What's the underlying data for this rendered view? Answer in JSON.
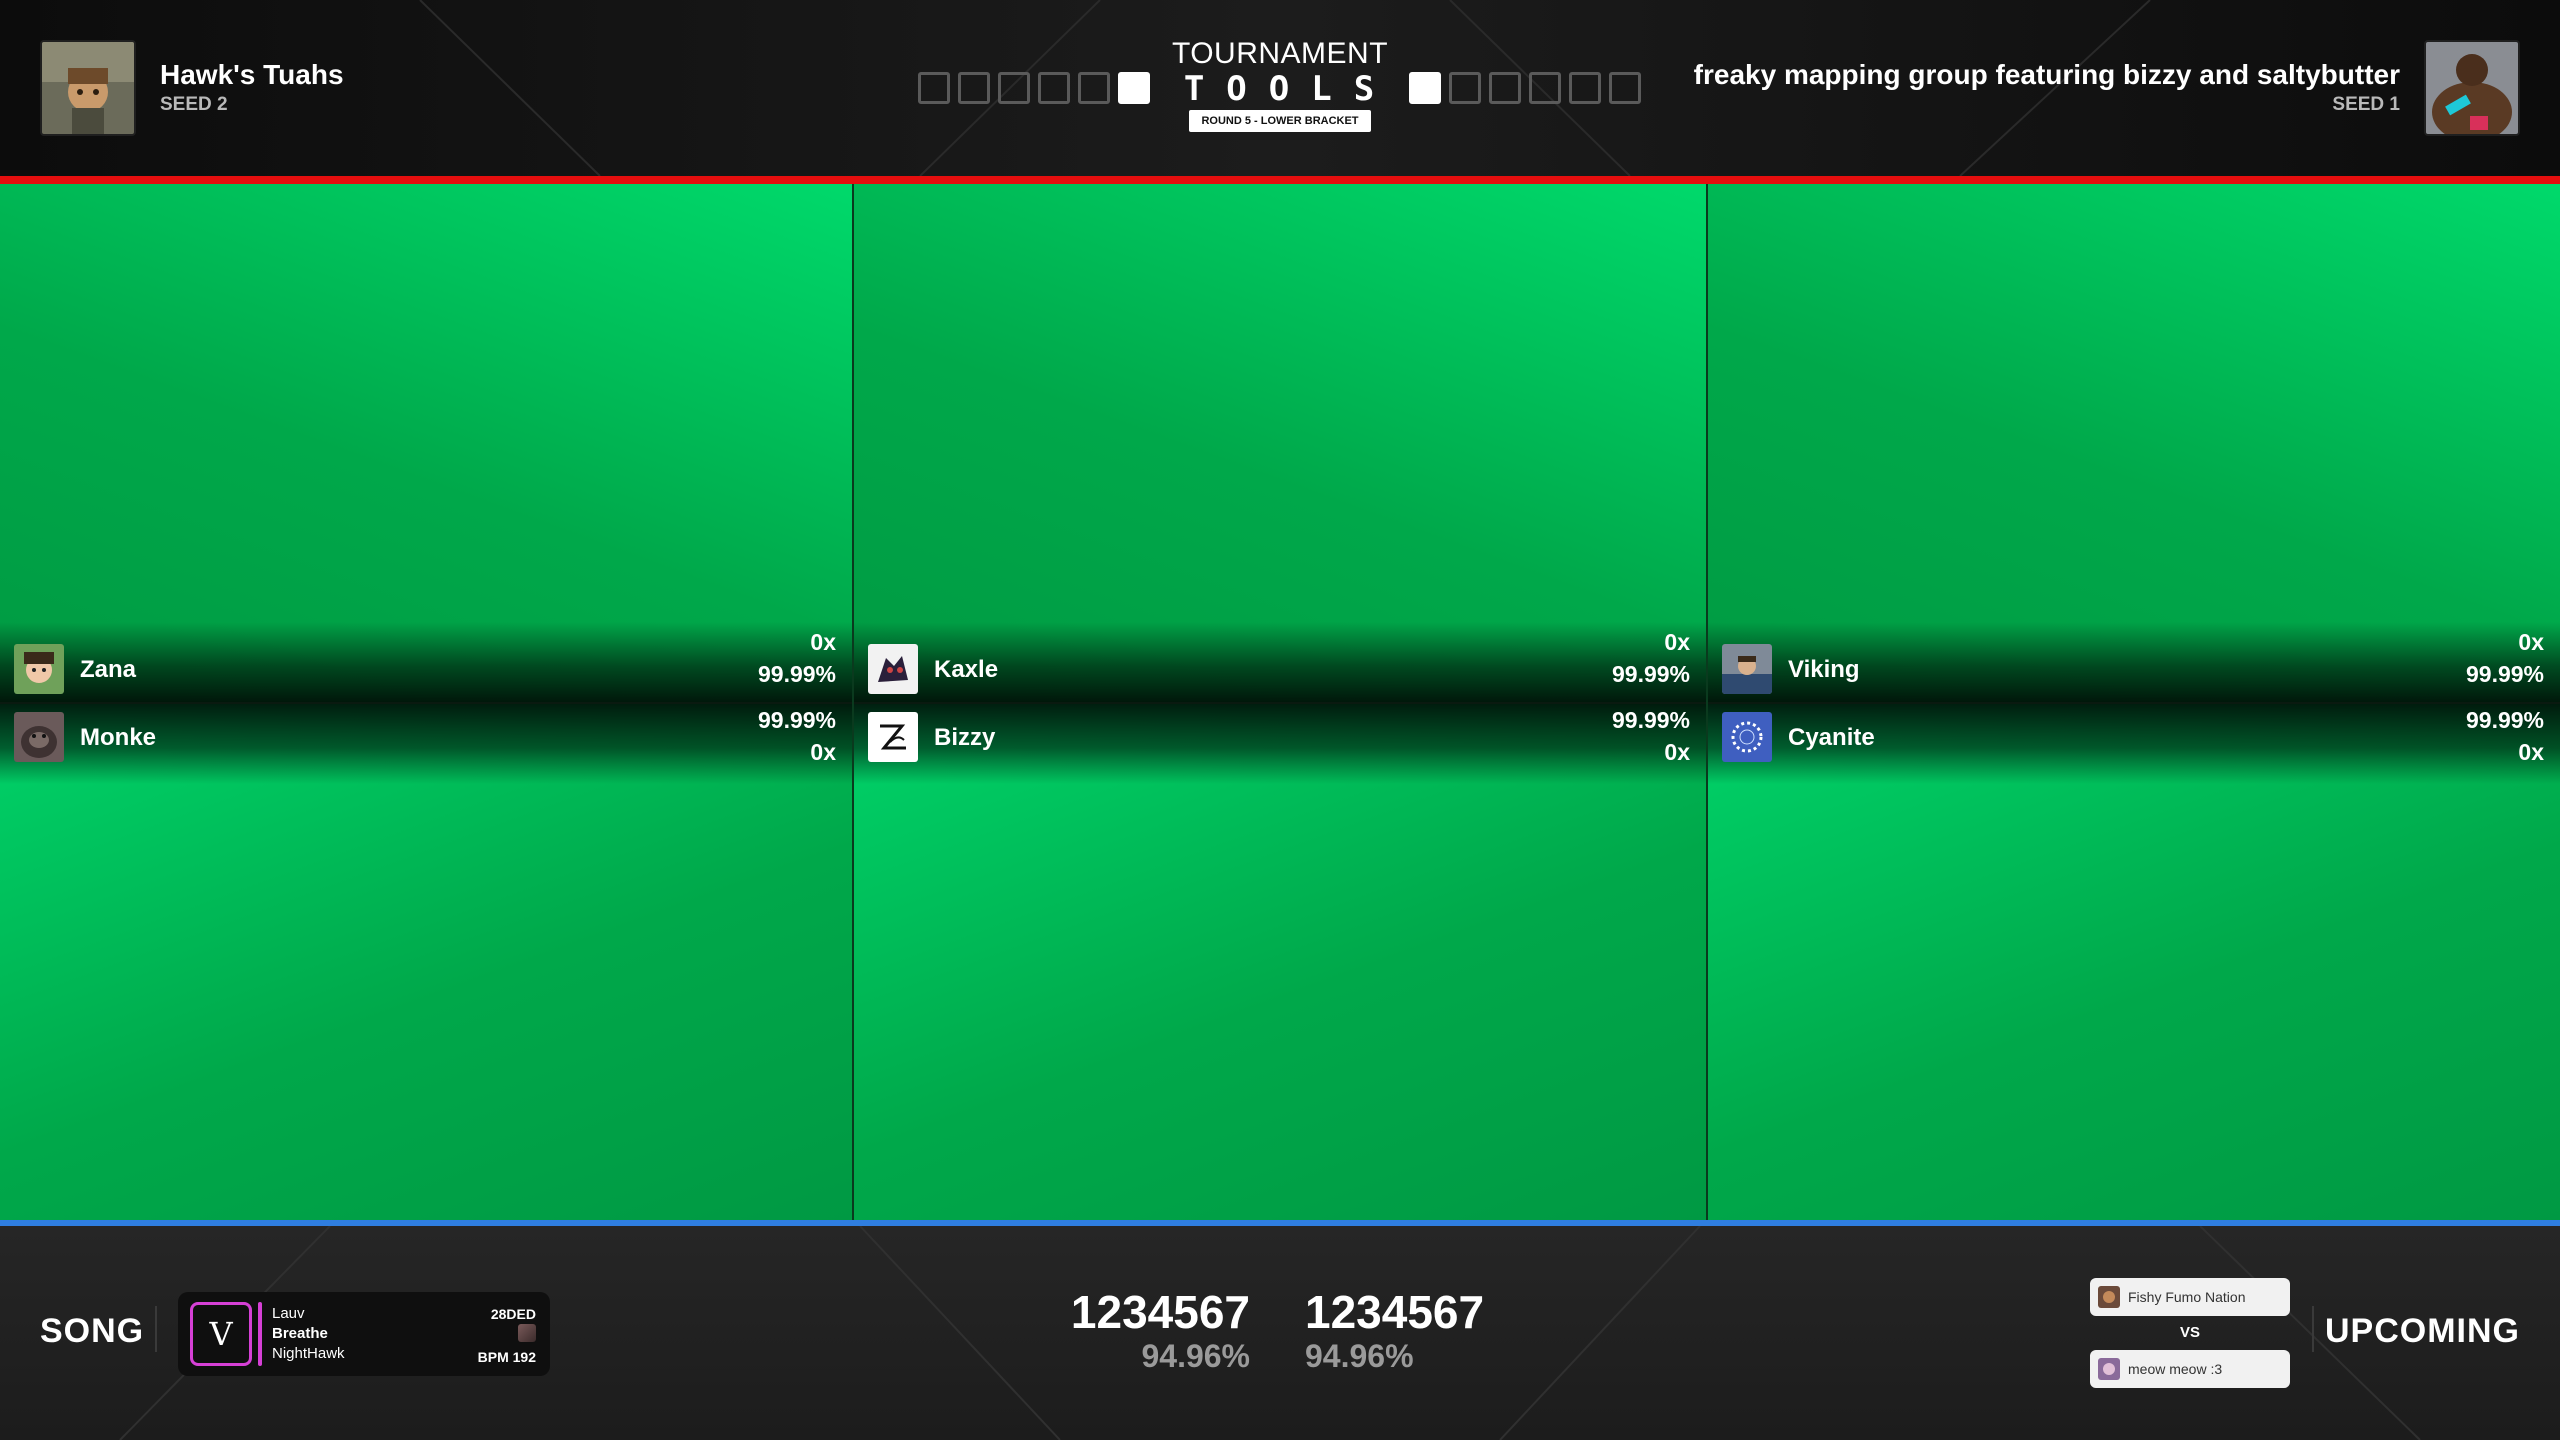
{
  "header": {
    "team_left": {
      "name": "Hawk's Tuahs",
      "seed": "SEED 2",
      "points_won": 1,
      "points_total": 6
    },
    "team_right": {
      "name": "freaky mapping group featuring bizzy and saltybutter",
      "seed": "SEED 1",
      "points_won": 1,
      "points_total": 6
    },
    "logo": {
      "line1": "TOURNAMENT",
      "line2": "TOOLS"
    },
    "round": "ROUND 5 - LOWER BRACKET"
  },
  "players": {
    "top": [
      {
        "name": "Zana",
        "combo": "0x",
        "accuracy": "99.99%"
      },
      {
        "name": "Kaxle",
        "combo": "0x",
        "accuracy": "99.99%"
      },
      {
        "name": "Viking",
        "combo": "0x",
        "accuracy": "99.99%"
      }
    ],
    "bottom": [
      {
        "name": "Monke",
        "accuracy": "99.99%",
        "combo": "0x"
      },
      {
        "name": "Bizzy",
        "accuracy": "99.99%",
        "combo": "0x"
      },
      {
        "name": "Cyanite",
        "accuracy": "99.99%",
        "combo": "0x"
      }
    ]
  },
  "footer": {
    "song_label": "SONG",
    "song": {
      "artist": "Lauv",
      "title": "Breathe",
      "mapper": "NightHawk",
      "code": "28DED",
      "bpm": "BPM 192",
      "cover_glyph": "V"
    },
    "score_left": {
      "score": "1234567",
      "accuracy": "94.96%"
    },
    "score_right": {
      "score": "1234567",
      "accuracy": "94.96%"
    },
    "upcoming_label": "UPCOMING",
    "upcoming": {
      "team_a": "Fishy Fumo Nation",
      "vs": "VS",
      "team_b": "meow meow :3"
    }
  },
  "colors": {
    "red_bar": "#e50e0e",
    "blue_bar": "#2f7ee0",
    "green_screen": "#00c05a",
    "song_accent": "#d640d6"
  },
  "icons": {
    "team_left_avatar": "anime-avatar",
    "team_right_avatar": "muscle-man-avatar"
  }
}
